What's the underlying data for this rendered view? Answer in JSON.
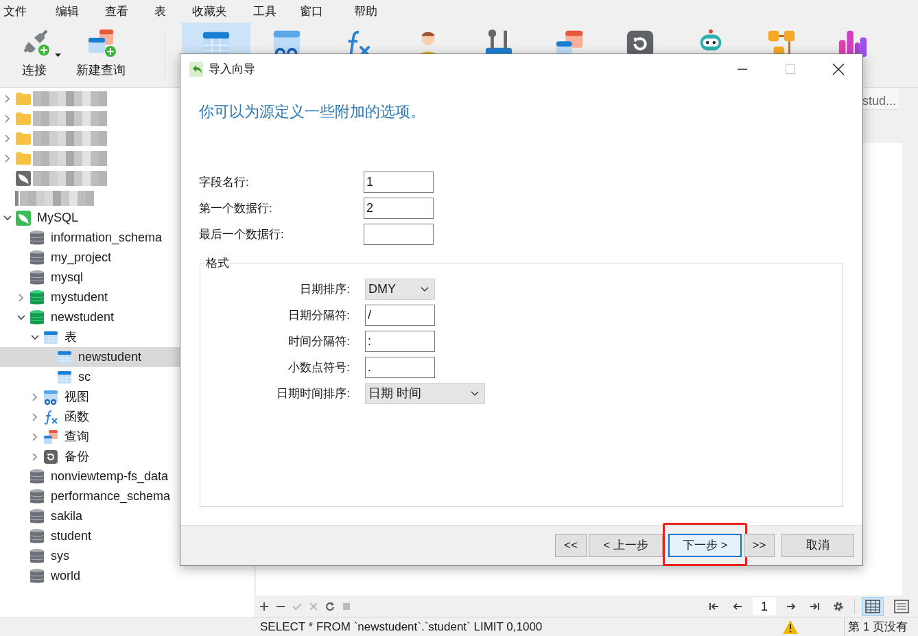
{
  "menu": [
    "文件",
    "编辑",
    "查看",
    "表",
    "收藏夹",
    "工具",
    "窗口",
    "帮助"
  ],
  "toolbar": {
    "buttons": [
      {
        "kind": "connect",
        "label": "连接",
        "dropdown": true
      },
      {
        "kind": "new-query",
        "label": "新建查询",
        "dropdown": false
      }
    ],
    "icons": [
      {
        "kind": "table",
        "selected": true
      },
      {
        "kind": "view",
        "selected": false
      },
      {
        "kind": "function",
        "selected": false
      },
      {
        "kind": "user",
        "selected": false
      },
      {
        "kind": "tools",
        "selected": false
      },
      {
        "kind": "query",
        "selected": false
      },
      {
        "kind": "backup",
        "selected": false
      },
      {
        "kind": "robot",
        "selected": false
      },
      {
        "kind": "model",
        "selected": false
      },
      {
        "kind": "chart",
        "selected": false
      }
    ]
  },
  "tree": [
    {
      "kind": "folder",
      "blurred": true,
      "expanded": false,
      "selected": false
    },
    {
      "kind": "folder",
      "blurred": true,
      "expanded": false,
      "selected": false
    },
    {
      "kind": "folder",
      "blurred": true,
      "expanded": false,
      "selected": false
    },
    {
      "kind": "folder",
      "blurred": true,
      "expanded": false,
      "selected": false
    },
    {
      "kind": "connection",
      "blurred": true,
      "selected": false
    },
    {
      "kind": "blank",
      "blurred": true,
      "selected": false
    },
    {
      "kind": "connection",
      "label": "MySQL",
      "expanded": true,
      "selected": false,
      "children": [
        {
          "kind": "database",
          "label": "information_schema",
          "active": false,
          "selected": false
        },
        {
          "kind": "database",
          "label": "my_project",
          "active": false,
          "selected": false
        },
        {
          "kind": "database",
          "label": "mysql",
          "active": false,
          "selected": false
        },
        {
          "kind": "database",
          "label": "mystudent",
          "active": true,
          "expanded": false,
          "selected": false
        },
        {
          "kind": "database",
          "label": "newstudent",
          "active": true,
          "expanded": true,
          "selected": false,
          "children": [
            {
              "kind": "tables",
              "label": "表",
              "expanded": true,
              "selected": false,
              "children": [
                {
                  "kind": "table",
                  "label": "newstudent",
                  "selected": true
                },
                {
                  "kind": "table",
                  "label": "sc",
                  "selected": false
                }
              ]
            },
            {
              "kind": "view",
              "label": "视图",
              "expanded": false,
              "selected": false
            },
            {
              "kind": "function",
              "label": "函数",
              "expanded": false,
              "selected": false
            },
            {
              "kind": "query",
              "label": "查询",
              "expanded": false,
              "selected": false
            },
            {
              "kind": "backup",
              "label": "备份",
              "expanded": false,
              "selected": false
            }
          ]
        },
        {
          "kind": "database",
          "label": "nonviewtemp-fs_data",
          "active": false,
          "selected": false
        },
        {
          "kind": "database",
          "label": "performance_schema",
          "active": false,
          "selected": false
        },
        {
          "kind": "database",
          "label": "sakila",
          "active": false,
          "selected": false
        },
        {
          "kind": "database",
          "label": "student",
          "active": false,
          "selected": false
        },
        {
          "kind": "database",
          "label": "sys",
          "active": false,
          "selected": false
        },
        {
          "kind": "database",
          "label": "world",
          "active": false,
          "selected": false
        }
      ]
    }
  ],
  "main": {
    "tab": "stud...",
    "page": "1",
    "views": [
      {
        "kind": "grid",
        "selected": true
      },
      {
        "kind": "form",
        "selected": false
      }
    ],
    "status": {
      "sql": "SELECT * FROM `newstudent`.`student` LIMIT 0,1000",
      "warning": true,
      "page_info": "第 1 页没有"
    }
  },
  "dialog": {
    "title": "导入向导",
    "heading": "你可以为源定义一些附加的选项。",
    "fields": [
      {
        "label": "字段名行:",
        "value": "1"
      },
      {
        "label": "第一个数据行:",
        "value": "2"
      },
      {
        "label": "最后一个数据行:"
      }
    ],
    "format": {
      "title": "格式",
      "fields": [
        {
          "kind": "select",
          "label": "日期排序:",
          "value": "DMY",
          "wide": false
        },
        {
          "kind": "text",
          "label": "日期分隔符:",
          "value": "/",
          "wide": false
        },
        {
          "kind": "text",
          "label": "时间分隔符:",
          "value": ":",
          "wide": false
        },
        {
          "kind": "text",
          "label": "小数点符号:",
          "value": ".",
          "wide": false
        },
        {
          "kind": "select",
          "label": "日期时间排序:",
          "value": "日期 时间",
          "wide": true
        }
      ]
    },
    "buttons": [
      {
        "label": "<<",
        "default": false,
        "highlighted": false
      },
      {
        "label": "< 上一步",
        "default": false,
        "highlighted": false
      },
      {
        "label": "下一步 >",
        "default": true,
        "highlighted": true
      },
      {
        "label": ">>",
        "default": false,
        "highlighted": false
      },
      {
        "label": "取消",
        "default": false,
        "highlighted": false
      }
    ]
  }
}
